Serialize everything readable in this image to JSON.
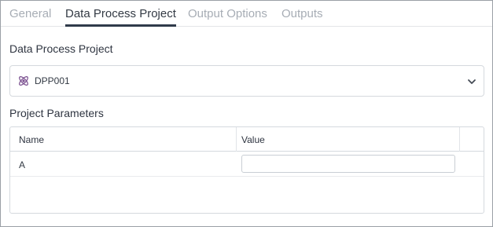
{
  "tabs": [
    {
      "label": "General",
      "active": false
    },
    {
      "label": "Data Process Project",
      "active": true
    },
    {
      "label": "Output Options",
      "active": false
    },
    {
      "label": "Outputs",
      "active": false
    }
  ],
  "project_section": {
    "label": "Data Process Project",
    "selected_value": "DPP001",
    "icon": "atom-icon",
    "chevron_icon": "chevron-down-icon"
  },
  "parameters_section": {
    "label": "Project Parameters",
    "columns": [
      "Name",
      "Value"
    ],
    "rows": [
      {
        "name": "A",
        "value": ""
      }
    ]
  },
  "colors": {
    "active_tab": "#333a44",
    "inactive_tab": "#a7adb5",
    "underline": "#2f3a4a",
    "border": "#d5d9de",
    "icon": "#7a4f8f"
  }
}
